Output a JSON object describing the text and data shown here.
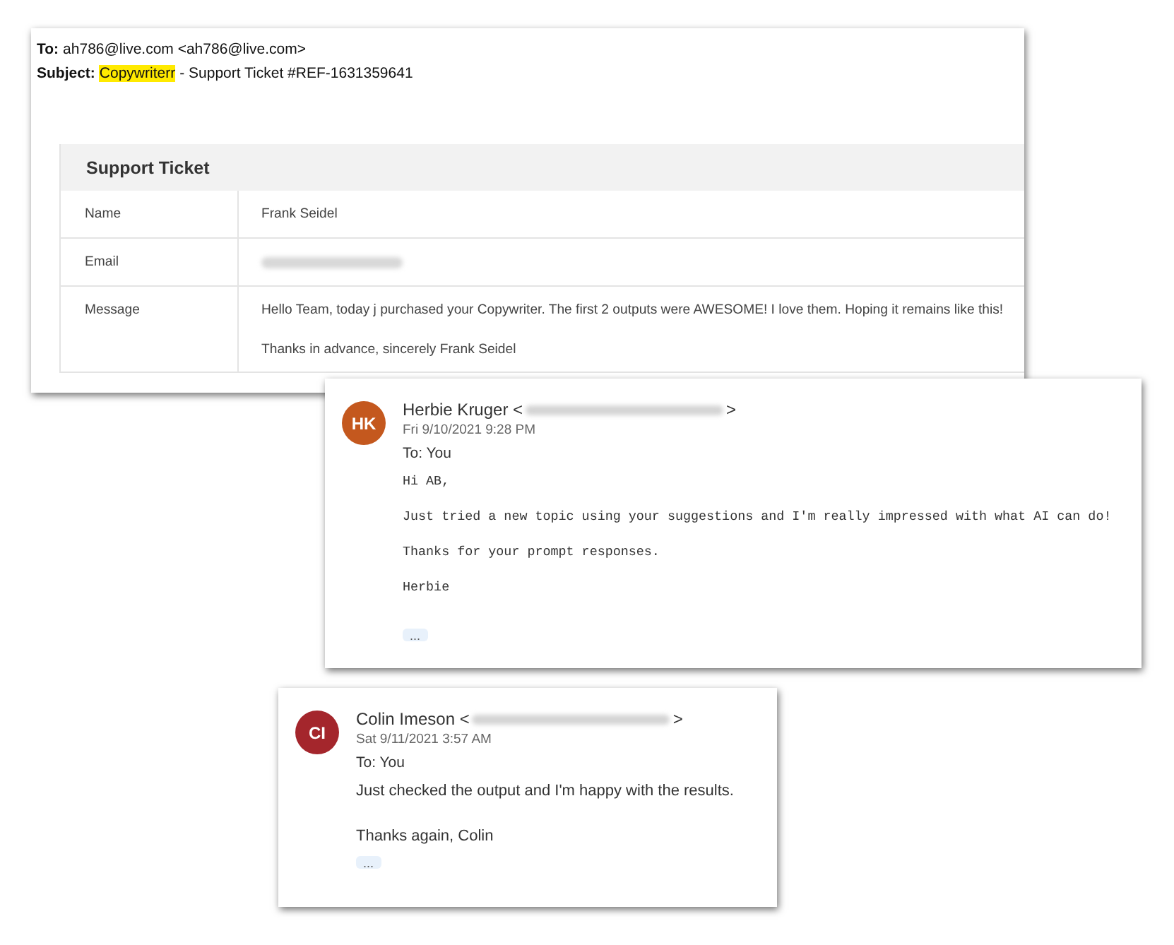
{
  "ticket_email": {
    "to_label": "To:",
    "to_value": "ah786@live.com <ah786@live.com>",
    "subject_label": "Subject:",
    "subject_highlight": "Copywriterr",
    "subject_rest": "- Support Ticket #REF-1631359641",
    "table": {
      "title": "Support Ticket",
      "rows": [
        {
          "label": "Name",
          "kind": "text",
          "lines": [
            "Frank Seidel"
          ]
        },
        {
          "label": "Email",
          "kind": "blurred"
        },
        {
          "label": "Message",
          "kind": "text",
          "lines": [
            "Hello Team, today j purchased your Copywriter. The first 2 outputs were AWESOME! I love them. Hoping it remains like this!",
            "Thanks in advance, sincerely Frank Seidel"
          ]
        }
      ]
    }
  },
  "messages": [
    {
      "initials": "HK",
      "color": "#c4581e",
      "sender": "Herbie Kruger <",
      "sender_end": ">",
      "date": "Fri 9/10/2021 9:28 PM",
      "to": "To:  You",
      "kind": "mono",
      "lines": [
        "Hi AB,",
        "Just tried a new topic using your suggestions and I'm really impressed with what AI can do!",
        "Thanks for your prompt responses.",
        "Herbie"
      ],
      "more": "..."
    },
    {
      "initials": "CI",
      "color": "#a4262c",
      "sender": "Colin Imeson <",
      "sender_end": ">",
      "date": "Sat 9/11/2021 3:57 AM",
      "to": "To:  You",
      "kind": "sans",
      "lines": [
        "Just checked the output and I'm happy with the results.",
        "Thanks again, Colin"
      ],
      "more": "..."
    }
  ]
}
